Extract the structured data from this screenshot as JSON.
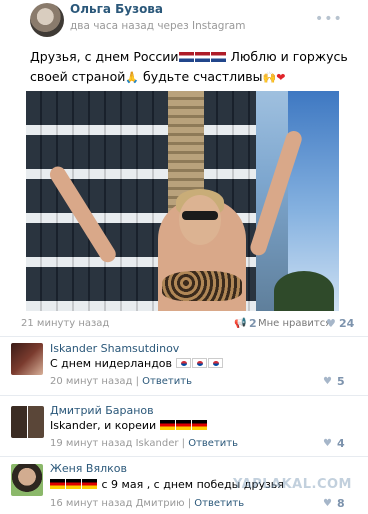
{
  "post": {
    "author": "Ольга Бузова",
    "meta": "два часа назад через Instagram",
    "menu_icon": "dots-icon",
    "text_line1": "Друзья, с днем России",
    "text_line1_end": " Люблю и горжусь",
    "text_line2_start": "своей страной",
    "text_line2_mid": " будьте счастливы",
    "flags": [
      "nl",
      "nl",
      "nl"
    ],
    "photo_description_icon": "photo",
    "footer": {
      "time": "21 минуту назад",
      "repost_count": "2",
      "like_label": "Мне нравится",
      "like_count": "24"
    }
  },
  "comments": [
    {
      "name": "Iskander Shamsutdinov",
      "text": "С днем нидерландов",
      "flags": [
        "kr",
        "kr",
        "kr"
      ],
      "time": "20 минут назад",
      "reply_label": "Ответить",
      "likes": "5"
    },
    {
      "name": "Дмитрий Баранов",
      "text": "Iskander, и кореии",
      "flags": [
        "de",
        "de",
        "de"
      ],
      "time": "19 минут назад Iskander",
      "reply_label": "Ответить",
      "likes": "4"
    },
    {
      "name": "Женя Вялков",
      "text_prefix_flags": [
        "de",
        "de",
        "de"
      ],
      "text": "с 9 мая , с днем победы друзья",
      "time": "16 минут назад Дмитрию",
      "reply_label": "Ответить",
      "likes": "8"
    }
  ],
  "watermark": "YAPLAKAL.COM",
  "colors": {
    "link": "#2b587a",
    "meta": "#999999",
    "count": "#7d93ad"
  }
}
